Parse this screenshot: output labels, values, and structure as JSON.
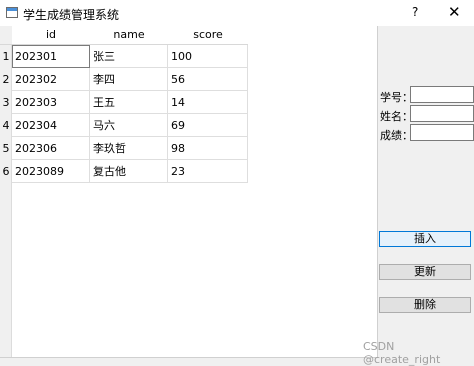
{
  "window": {
    "title": "学生成绩管理系统",
    "help": "?",
    "close": "✕"
  },
  "table": {
    "columns": [
      "id",
      "name",
      "score"
    ],
    "rows": [
      {
        "num": "1",
        "id": "202301",
        "name": "张三",
        "score": "100"
      },
      {
        "num": "2",
        "id": "202302",
        "name": "李四",
        "score": "56"
      },
      {
        "num": "3",
        "id": "202303",
        "name": "王五",
        "score": "14"
      },
      {
        "num": "4",
        "id": "202304",
        "name": "马六",
        "score": "69"
      },
      {
        "num": "5",
        "id": "202306",
        "name": "李玖哲",
        "score": "98"
      },
      {
        "num": "6",
        "id": "2023089",
        "name": "复古他",
        "score": "23"
      }
    ]
  },
  "form": {
    "id_label": "学号：",
    "name_label": "姓名：",
    "score_label": "成绩：",
    "id_value": "",
    "name_value": "",
    "score_value": ""
  },
  "buttons": {
    "insert": "插入",
    "update": "更新",
    "delete": "删除"
  },
  "watermark": "CSDN @create_right"
}
